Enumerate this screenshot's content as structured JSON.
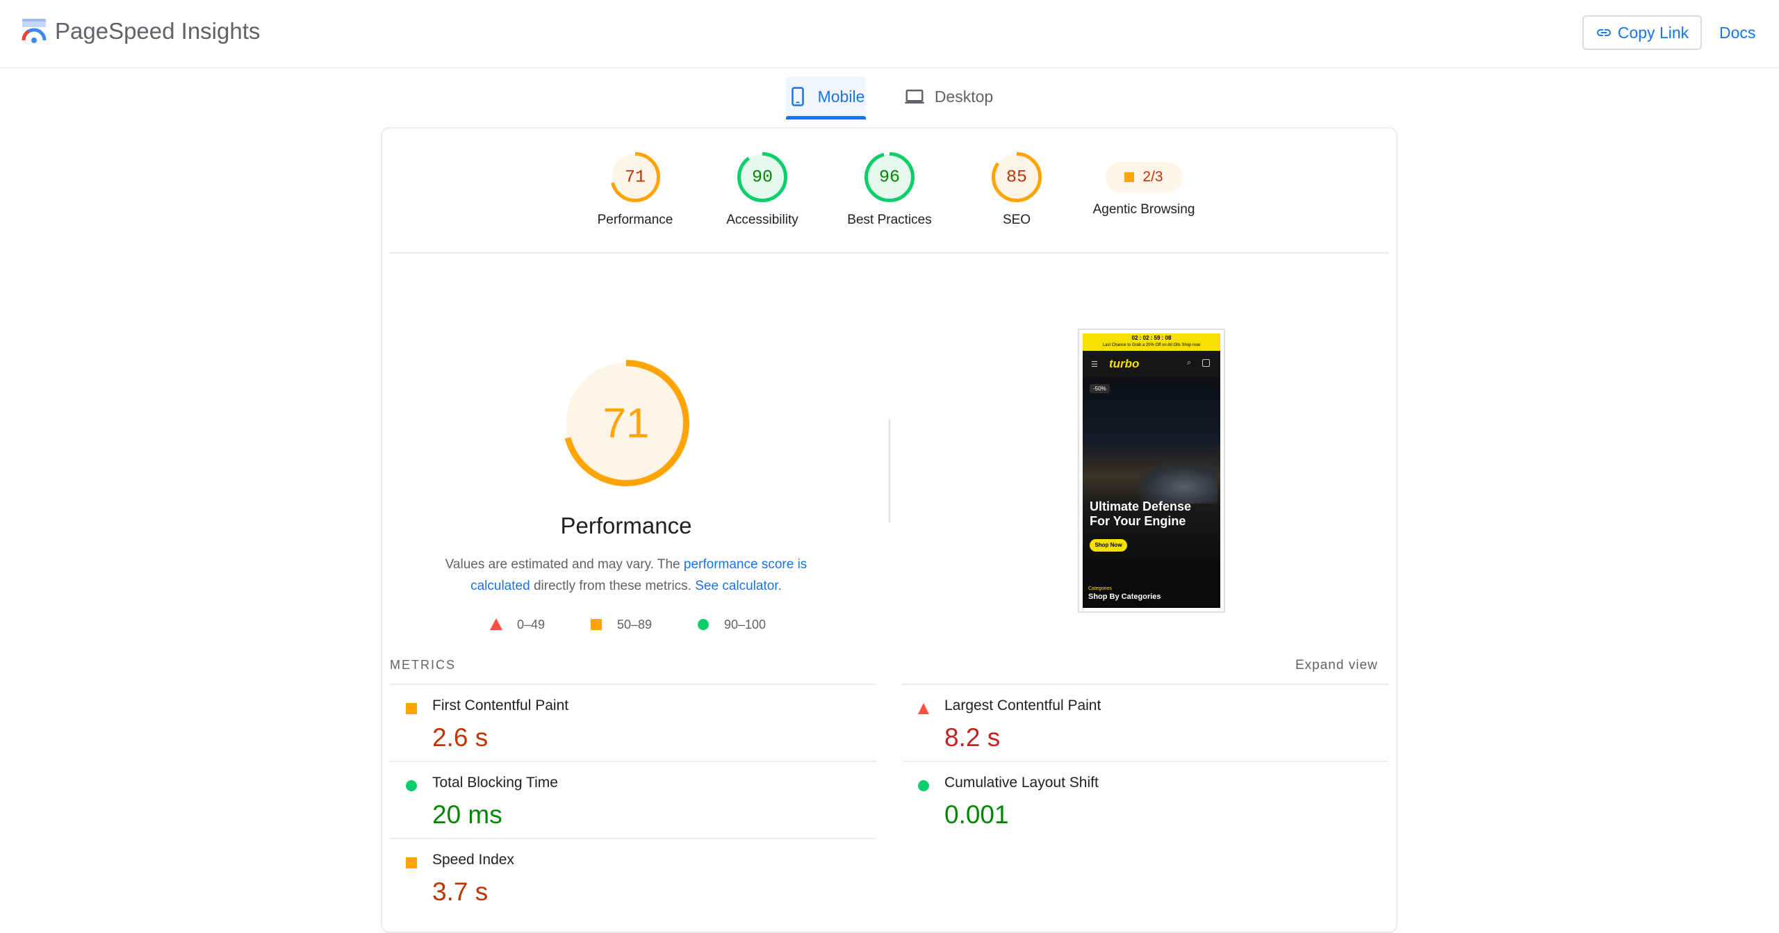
{
  "header": {
    "app_title": "PageSpeed Insights",
    "copy_link_label": "Copy Link",
    "docs_label": "Docs"
  },
  "tabs": [
    {
      "label": "Mobile",
      "icon": "smartphone-icon",
      "selected": true
    },
    {
      "label": "Desktop",
      "icon": "laptop-icon",
      "selected": false
    }
  ],
  "colors": {
    "accent": "#1a73e8",
    "average": "#ffa400",
    "average_text": "#c33300",
    "pass": "#0cce6b",
    "pass_text": "#008800",
    "fail": "#ff4e42",
    "fail_text": "#c5221f"
  },
  "gauges": [
    {
      "label": "Performance",
      "score": "71",
      "value": 71,
      "rating": "average"
    },
    {
      "label": "Accessibility",
      "score": "90",
      "value": 90,
      "rating": "pass"
    },
    {
      "label": "Best Practices",
      "score": "96",
      "value": 96,
      "rating": "pass"
    },
    {
      "label": "SEO",
      "score": "85",
      "value": 85,
      "rating": "average"
    },
    {
      "label": "Agentic Browsing",
      "score": "2/3",
      "rating": "average"
    }
  ],
  "performance": {
    "score": "71",
    "value": 71,
    "title": "Performance",
    "desc_prefix": "Values are estimated and may vary. The",
    "desc_link1": "performance score is calculated",
    "desc_middle": "directly from these metrics.",
    "desc_link2": "See calculator."
  },
  "legend": [
    {
      "range": "0–49",
      "icon": "triangle-icon"
    },
    {
      "range": "50–89",
      "icon": "square-icon"
    },
    {
      "range": "90–100",
      "icon": "circle-icon"
    }
  ],
  "screenshot": {
    "promo_timer": "02 : 02 : 59 : 08",
    "promo_text": "Last Chance to Grab a 20% Off on All Oils  Shop now",
    "brand": "turbo",
    "badge": "-50%",
    "hero_title": "Ultimate Defense For Your Engine",
    "shop_button": "Shop Now",
    "categories_small": "Categories",
    "categories_title": "Shop By Categories"
  },
  "metrics": {
    "heading": "METRICS",
    "expand_label": "Expand view",
    "items": [
      {
        "label": "First Contentful Paint",
        "value": "2.6 s",
        "rating": "average"
      },
      {
        "label": "Largest Contentful Paint",
        "value": "8.2 s",
        "rating": "fail"
      },
      {
        "label": "Total Blocking Time",
        "value": "20 ms",
        "rating": "pass"
      },
      {
        "label": "Cumulative Layout Shift",
        "value": "0.001",
        "rating": "pass"
      },
      {
        "label": "Speed Index",
        "value": "3.7 s",
        "rating": "average"
      }
    ]
  }
}
